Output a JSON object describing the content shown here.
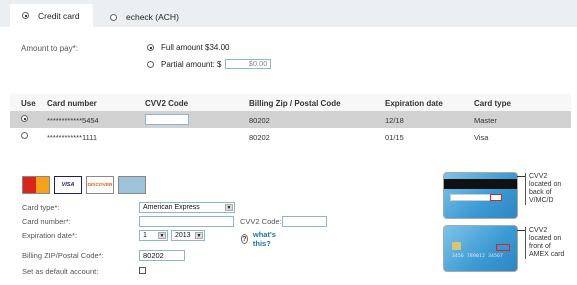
{
  "tabs": [
    {
      "label": "Credit card",
      "selected": true
    },
    {
      "label": "echeck (ACH)",
      "selected": false
    }
  ],
  "amount": {
    "label": "Amount to pay*:",
    "full_label": "Full amount $34.00",
    "partial_label": "Partial amount: $",
    "partial_value": "$0.00"
  },
  "table": {
    "headers": [
      "Use",
      "Card number",
      "CVV2 Code",
      "Billing Zip / Postal Code",
      "Expiration date",
      "Card type"
    ],
    "rows": [
      {
        "selected": true,
        "number": "************5454",
        "zip": "80202",
        "exp": "12/18",
        "type": "Master"
      },
      {
        "selected": false,
        "number": "************1111",
        "zip": "80202",
        "exp": "01/15",
        "type": "Visa"
      }
    ]
  },
  "logos": [
    {
      "name": "mastercard-logo",
      "text": "MasterCard"
    },
    {
      "name": "visa-logo",
      "text": "VISA"
    },
    {
      "name": "discover-logo",
      "text": "DISCOVER"
    },
    {
      "name": "amex-logo",
      "text": "AMEX"
    }
  ],
  "form": {
    "card_type_label": "Card type*:",
    "card_type_value": "American Express",
    "card_number_label": "Card number*:",
    "cvv_label": "CVV2 Code:",
    "exp_label": "Expiration date*:",
    "exp_month": "1",
    "exp_year": "2013",
    "whats_this": "what's this?",
    "zip_label": "Billing ZIP/Postal Code*:",
    "zip_value": "80202",
    "default_label": "Set as default account:"
  },
  "notes": {
    "back": "CVV2 located on back of V/MC/D",
    "front": "CVV2 located on front of AMEX card"
  },
  "colors": {
    "tab_bg": "#eceff1",
    "selected_row": "#d2d2d2",
    "link": "#1f6fb2",
    "input_border": "#8fb4cf"
  }
}
